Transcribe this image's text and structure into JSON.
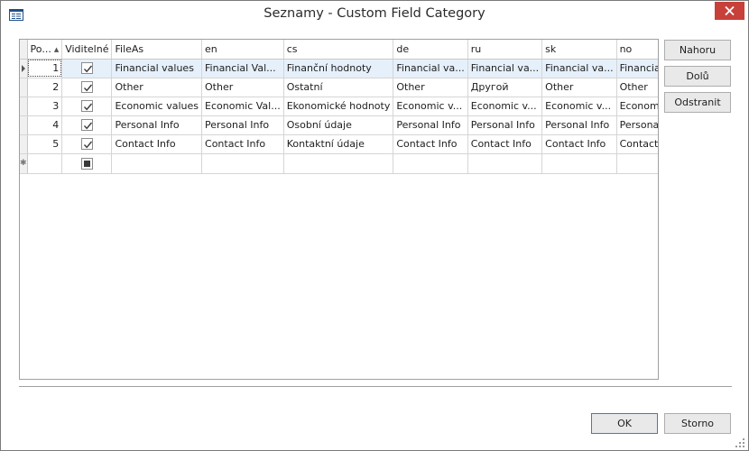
{
  "window": {
    "title": "Seznamy - Custom Field Category"
  },
  "grid": {
    "columns": [
      "Po...",
      "Viditelné",
      "FileAs",
      "en",
      "cs",
      "de",
      "ru",
      "sk",
      "no"
    ],
    "rows": [
      {
        "order": "1",
        "visible": true,
        "fileas": "Financial values",
        "en": "Financial Val...",
        "cs": "Finanční hodnoty",
        "de": "Financial va...",
        "ru": "Financial va...",
        "sk": "Financial va...",
        "no": "Financial values"
      },
      {
        "order": "2",
        "visible": true,
        "fileas": "Other",
        "en": "Other",
        "cs": "Ostatní",
        "de": "Other",
        "ru": "Другой",
        "sk": "Other",
        "no": "Other"
      },
      {
        "order": "3",
        "visible": true,
        "fileas": "Economic values",
        "en": "Economic Val...",
        "cs": "Ekonomické hodnoty",
        "de": "Economic v...",
        "ru": "Economic v...",
        "sk": "Economic v...",
        "no": "Economic values"
      },
      {
        "order": "4",
        "visible": true,
        "fileas": "Personal Info",
        "en": "Personal Info",
        "cs": "Osobní údaje",
        "de": "Personal Info",
        "ru": "Personal Info",
        "sk": "Personal Info",
        "no": "Personal Info"
      },
      {
        "order": "5",
        "visible": true,
        "fileas": "Contact Info",
        "en": "Contact Info",
        "cs": "Kontaktní údaje",
        "de": "Contact Info",
        "ru": "Contact Info",
        "sk": "Contact Info",
        "no": "Contact Info"
      }
    ],
    "selected_row": 0
  },
  "side_buttons": {
    "up": "Nahoru",
    "down": "Dolů",
    "remove": "Odstranit"
  },
  "footer": {
    "ok": "OK",
    "cancel": "Storno"
  },
  "colors": {
    "selection": "#e6f0fb",
    "close": "#c7403a",
    "primary_border": "#3a7bd5"
  },
  "icons": {
    "app": "list-window-icon",
    "close": "close-icon",
    "sort": "sort-ascending-icon",
    "check": "check-icon",
    "row_pointer": "row-pointer-icon",
    "new_row": "new-row-icon",
    "grip": "resize-grip-icon"
  }
}
